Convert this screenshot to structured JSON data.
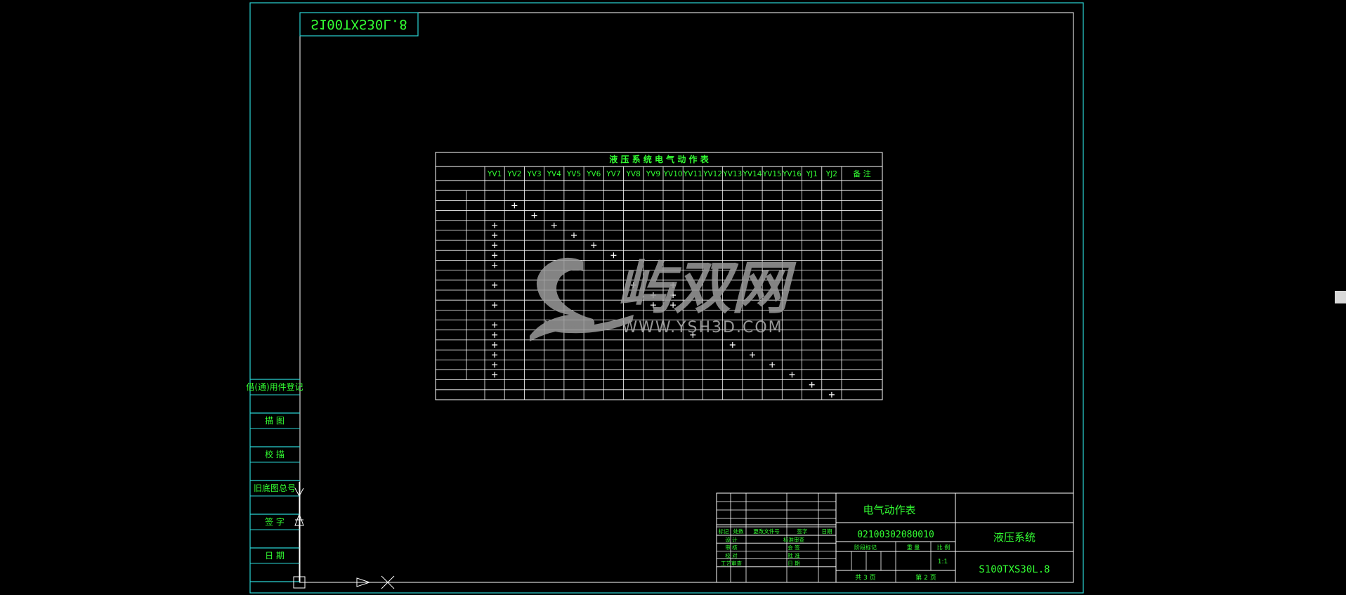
{
  "colors": {
    "background": "#000000",
    "frame_line": "#2ad4d4",
    "table_line": "#ffffff",
    "cad_text": "#33ff33",
    "watermark": "#9a9a9a",
    "scroll_thumb": "#d8d8d8"
  },
  "drawing_code_mirrored": "S100TXS30L.8",
  "side_column": {
    "labels": [
      "借(通)用件登记",
      "描 图",
      "校 描",
      "旧底图总号",
      "签 字",
      "日 期"
    ]
  },
  "table": {
    "title": "液 压 系 统 电 气 动 作 表",
    "columns": [
      "YV1",
      "YV2",
      "YV3",
      "YV4",
      "YV5",
      "YV6",
      "YV7",
      "YV8",
      "YV9",
      "YV10",
      "YV11",
      "YV12",
      "YV13",
      "YV14",
      "YV15",
      "YV16",
      "YJ1",
      "YJ2"
    ],
    "remarks_header": "备 注",
    "row_labels": [
      "",
      "",
      "",
      "",
      "",
      "",
      "",
      "",
      "",
      "",
      "",
      "",
      "",
      "",
      "",
      "",
      "",
      "",
      "",
      "",
      "",
      ""
    ],
    "remarks_lines": [
      "",
      "",
      ""
    ],
    "marks": [
      [
        2,
        1
      ],
      [
        3,
        2
      ],
      [
        4,
        0
      ],
      [
        4,
        3
      ],
      [
        5,
        0
      ],
      [
        5,
        4
      ],
      [
        6,
        0
      ],
      [
        6,
        5
      ],
      [
        7,
        0
      ],
      [
        7,
        6
      ],
      [
        8,
        0
      ],
      [
        10,
        0
      ],
      [
        10,
        7
      ],
      [
        10,
        9
      ],
      [
        11,
        8
      ],
      [
        11,
        9
      ],
      [
        12,
        0
      ],
      [
        12,
        8
      ],
      [
        12,
        9
      ],
      [
        14,
        0
      ],
      [
        15,
        0
      ],
      [
        15,
        10
      ],
      [
        16,
        0
      ],
      [
        16,
        12
      ],
      [
        17,
        0
      ],
      [
        17,
        13
      ],
      [
        18,
        0
      ],
      [
        18,
        14
      ],
      [
        19,
        0
      ],
      [
        19,
        15
      ],
      [
        20,
        16
      ],
      [
        21,
        17
      ]
    ]
  },
  "watermark": {
    "brand": "屿双网",
    "url": "WWW.YSH3D.COM"
  },
  "title_block": {
    "name": "电气动作表",
    "doc_number": "02100302080010",
    "system": "液压系统",
    "code": "S100TXS30L.8",
    "scale": "1:1",
    "sheets_total": "共 3 页",
    "sheet_no": "第 2 页",
    "headers": [
      "标记",
      "处数",
      "更改文件号",
      "签字",
      "日期"
    ],
    "approval_labels": [
      "设 计",
      "审 核",
      "校 对",
      "工艺审查",
      "标准审查",
      "会 签",
      "批 准",
      "日 期"
    ],
    "stage_headers": [
      "阶段标记",
      "重 量",
      "比 例"
    ]
  }
}
